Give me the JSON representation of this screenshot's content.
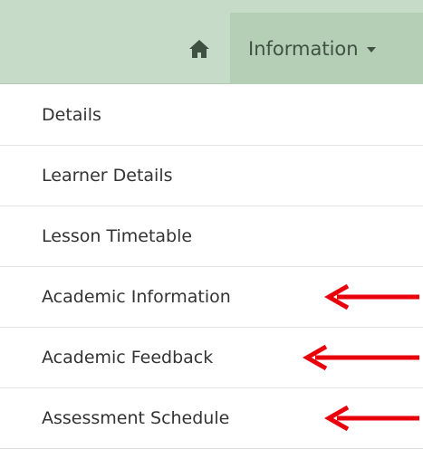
{
  "navbar": {
    "home_icon": "home-icon",
    "information_label": "Information",
    "dropdown_icon": "caret-down-icon"
  },
  "menu": {
    "items": [
      {
        "label": "Details",
        "highlighted": false
      },
      {
        "label": "Learner Details",
        "highlighted": false
      },
      {
        "label": "Lesson Timetable",
        "highlighted": false
      },
      {
        "label": "Academic Information",
        "highlighted": true
      },
      {
        "label": "Academic Feedback",
        "highlighted": true
      },
      {
        "label": "Assessment Schedule",
        "highlighted": true
      }
    ]
  },
  "colors": {
    "navbar_bg": "#c7dcc8",
    "active_tab_bg": "#b4cfb5",
    "nav_text": "#3f5241",
    "menu_text": "#333333",
    "annotation_arrow": "#e8000b"
  }
}
